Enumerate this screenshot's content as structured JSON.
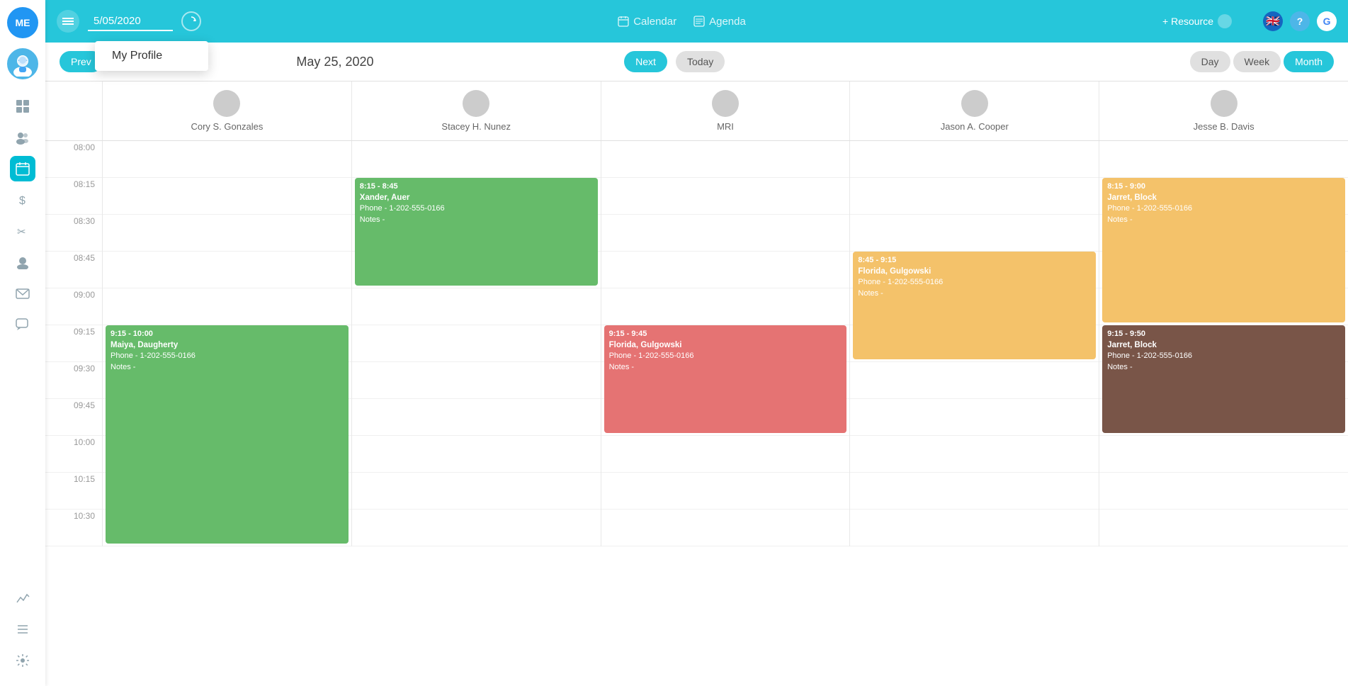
{
  "sidebar": {
    "me_label": "ME",
    "items": [
      {
        "id": "dashboard",
        "icon": "⊞",
        "active": false
      },
      {
        "id": "patients",
        "icon": "👥",
        "active": false
      },
      {
        "id": "calendar",
        "icon": "📅",
        "active": true
      },
      {
        "id": "billing",
        "icon": "$",
        "active": false
      },
      {
        "id": "scissors",
        "icon": "✂",
        "active": false
      },
      {
        "id": "contacts",
        "icon": "👤",
        "active": false
      },
      {
        "id": "mail",
        "icon": "✉",
        "active": false
      },
      {
        "id": "chat",
        "icon": "💬",
        "active": false
      },
      {
        "id": "analytics",
        "icon": "📈",
        "active": false
      },
      {
        "id": "list",
        "icon": "☰",
        "active": false
      },
      {
        "id": "settings",
        "icon": "⚙",
        "active": false
      }
    ]
  },
  "topbar": {
    "date_value": "5/05/2020",
    "calendar_label": "Calendar",
    "agenda_label": "Agenda",
    "resource_label": "+ Resource"
  },
  "profile_dropdown": {
    "label": "My Profile"
  },
  "calendar": {
    "current_date": "May 25, 2020",
    "prev_label": "Prev",
    "next_label": "Next",
    "today_label": "Today",
    "views": [
      "Day",
      "Week",
      "Month"
    ],
    "active_view": "Month",
    "resources": [
      {
        "name": "Cory S. Gonzales"
      },
      {
        "name": "Stacey H. Nunez"
      },
      {
        "name": "MRI"
      },
      {
        "name": "Jason A. Cooper"
      },
      {
        "name": "Jesse B. Davis"
      }
    ],
    "time_slots": [
      "08:00",
      "08:15",
      "08:30",
      "08:45",
      "09:00",
      "09:15",
      "09:30",
      "09:45",
      "10:00",
      "10:15",
      "10:30"
    ],
    "events": [
      {
        "id": "ev1",
        "resource_index": 1,
        "color": "ev-green",
        "time": "8:15 - 8:45",
        "name": "Xander, Auer",
        "phone": "Phone - 1-202-555-0166",
        "notes": "Notes -",
        "top_slot": 1,
        "height_slots": 3
      },
      {
        "id": "ev2",
        "resource_index": 4,
        "color": "ev-orange",
        "time": "8:15 - 9:00",
        "name": "Jarret, Block",
        "phone": "Phone - 1-202-555-0166",
        "notes": "Notes -",
        "top_slot": 1,
        "height_slots": 4
      },
      {
        "id": "ev3",
        "resource_index": 3,
        "color": "ev-orange",
        "time": "8:45 - 9:15",
        "name": "Florida, Gulgowski",
        "phone": "Phone - 1-202-555-0166",
        "notes": "Notes -",
        "top_slot": 3,
        "height_slots": 3
      },
      {
        "id": "ev4",
        "resource_index": 0,
        "color": "ev-green",
        "time": "9:15 - 10:00",
        "name": "Maiya, Daugherty",
        "phone": "Phone - 1-202-555-0166",
        "notes": "Notes -",
        "top_slot": 5,
        "height_slots": 6
      },
      {
        "id": "ev5",
        "resource_index": 2,
        "color": "ev-red",
        "time": "9:15 - 9:45",
        "name": "Florida, Gulgowski",
        "phone": "Phone - 1-202-555-0166",
        "notes": "Notes -",
        "top_slot": 5,
        "height_slots": 3
      },
      {
        "id": "ev6",
        "resource_index": 4,
        "color": "ev-brown",
        "time": "9:15 - 9:50",
        "name": "Jarret, Block",
        "phone": "Phone - 1-202-555-0166",
        "notes": "Notes -",
        "top_slot": 5,
        "height_slots": 3
      }
    ]
  }
}
